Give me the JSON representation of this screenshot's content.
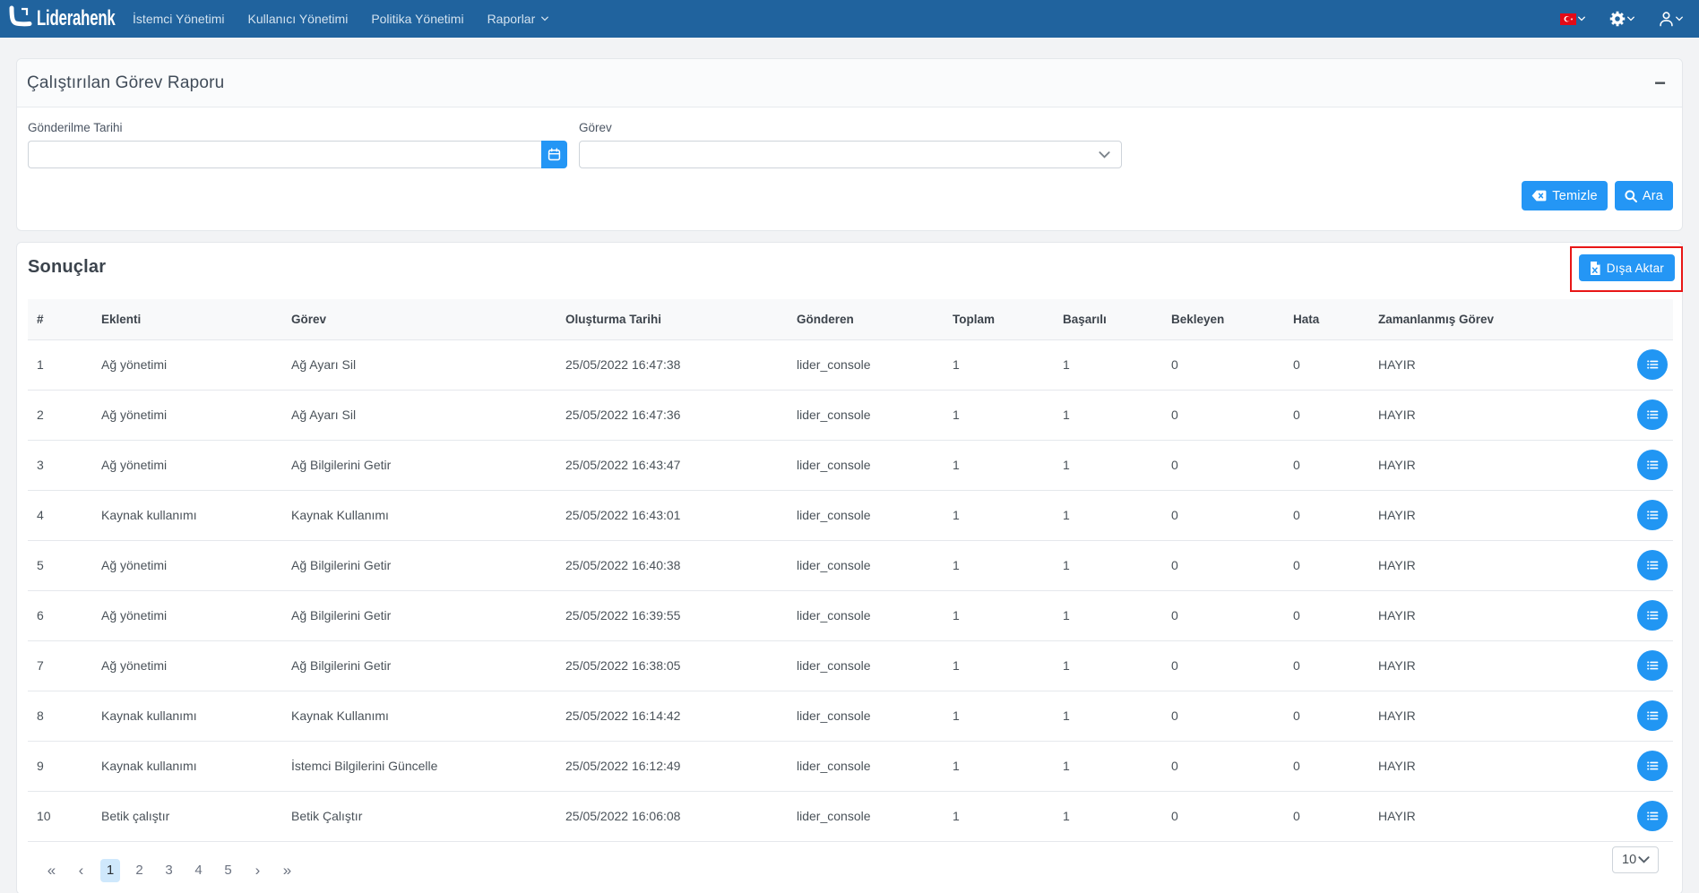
{
  "brand": {
    "name": "Liderahenk"
  },
  "navbar": {
    "items": [
      {
        "label": "İstemci Yönetimi",
        "dropdown": false
      },
      {
        "label": "Kullanıcı Yönetimi",
        "dropdown": false
      },
      {
        "label": "Politika Yönetimi",
        "dropdown": false
      },
      {
        "label": "Raporlar",
        "dropdown": true
      }
    ],
    "right_icons": [
      "turkish-flag",
      "gear",
      "user"
    ]
  },
  "filter_card": {
    "title": "Çalıştırılan Görev Raporu",
    "collapse_icon": "−",
    "fields": [
      {
        "label": "Gönderilme Tarihi",
        "value": "",
        "type": "date"
      },
      {
        "label": "Görev",
        "value": "",
        "type": "select"
      }
    ],
    "buttons": {
      "clear": "Temizle",
      "search": "Ara"
    }
  },
  "results": {
    "title": "Sonuçlar",
    "export_label": "Dışa Aktar",
    "table": {
      "columns": [
        "#",
        "Eklenti",
        "Görev",
        "Oluşturma Tarihi",
        "Gönderen",
        "Toplam",
        "Başarılı",
        "Bekleyen",
        "Hata",
        "Zamanlanmış Görev"
      ],
      "rows": [
        [
          "1",
          "Ağ yönetimi",
          "Ağ Ayarı Sil",
          "25/05/2022 16:47:38",
          "lider_console",
          "1",
          "1",
          "0",
          "0",
          "HAYIR"
        ],
        [
          "2",
          "Ağ yönetimi",
          "Ağ Ayarı Sil",
          "25/05/2022 16:47:36",
          "lider_console",
          "1",
          "1",
          "0",
          "0",
          "HAYIR"
        ],
        [
          "3",
          "Ağ yönetimi",
          "Ağ Bilgilerini Getir",
          "25/05/2022 16:43:47",
          "lider_console",
          "1",
          "1",
          "0",
          "0",
          "HAYIR"
        ],
        [
          "4",
          "Kaynak kullanımı",
          "Kaynak Kullanımı",
          "25/05/2022 16:43:01",
          "lider_console",
          "1",
          "1",
          "0",
          "0",
          "HAYIR"
        ],
        [
          "5",
          "Ağ yönetimi",
          "Ağ Bilgilerini Getir",
          "25/05/2022 16:40:38",
          "lider_console",
          "1",
          "1",
          "0",
          "0",
          "HAYIR"
        ],
        [
          "6",
          "Ağ yönetimi",
          "Ağ Bilgilerini Getir",
          "25/05/2022 16:39:55",
          "lider_console",
          "1",
          "1",
          "0",
          "0",
          "HAYIR"
        ],
        [
          "7",
          "Ağ yönetimi",
          "Ağ Bilgilerini Getir",
          "25/05/2022 16:38:05",
          "lider_console",
          "1",
          "1",
          "0",
          "0",
          "HAYIR"
        ],
        [
          "8",
          "Kaynak kullanımı",
          "Kaynak Kullanımı",
          "25/05/2022 16:14:42",
          "lider_console",
          "1",
          "1",
          "0",
          "0",
          "HAYIR"
        ],
        [
          "9",
          "Kaynak kullanımı",
          "İstemci Bilgilerini Güncelle",
          "25/05/2022 16:12:49",
          "lider_console",
          "1",
          "1",
          "0",
          "0",
          "HAYIR"
        ],
        [
          "10",
          "Betik çalıştır",
          "Betik Çalıştır",
          "25/05/2022 16:06:08",
          "lider_console",
          "1",
          "1",
          "0",
          "0",
          "HAYIR"
        ]
      ]
    },
    "pagination": {
      "first": "«",
      "prev": "‹",
      "pages": [
        "1",
        "2",
        "3",
        "4",
        "5"
      ],
      "next": "›",
      "last": "»",
      "active_page": "1",
      "page_size": "10"
    }
  },
  "colors": {
    "navbar_blue": "#20639e",
    "accent_blue": "#2496f5",
    "annotation_red": "#e81616",
    "flag_red": "#e30a17"
  }
}
